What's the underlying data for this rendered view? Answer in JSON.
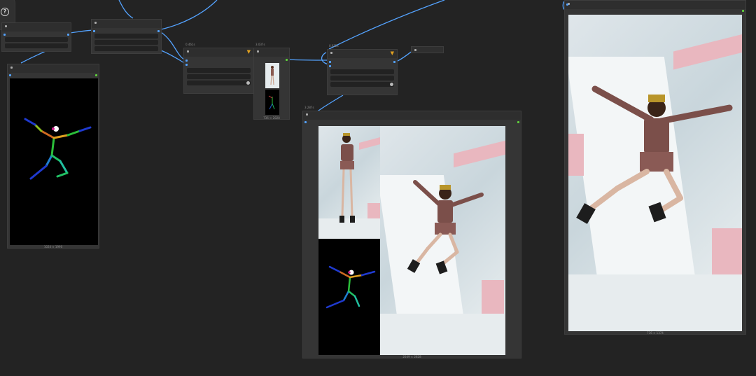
{
  "app": {
    "help_icon": "question-mark-icon",
    "help_glyph": "?"
  },
  "nodes": {
    "ksampler_a": {
      "time": "0.461s"
    },
    "preview_small": {
      "time": "3.037s",
      "caption": "736 × 2828"
    },
    "ksampler_b": {
      "time": "0.632s"
    },
    "pose_preview": {
      "caption": "1024 × 1990"
    },
    "compare_preview": {
      "time": "3.287s",
      "caption": "2049 × 2828"
    },
    "final_preview": {
      "caption": "736 × 1374"
    }
  },
  "colors": {
    "wire": "#54a3ff",
    "input_port": "#54a3ff",
    "output_port": "#5fd03b",
    "filter": "#e0a020"
  }
}
